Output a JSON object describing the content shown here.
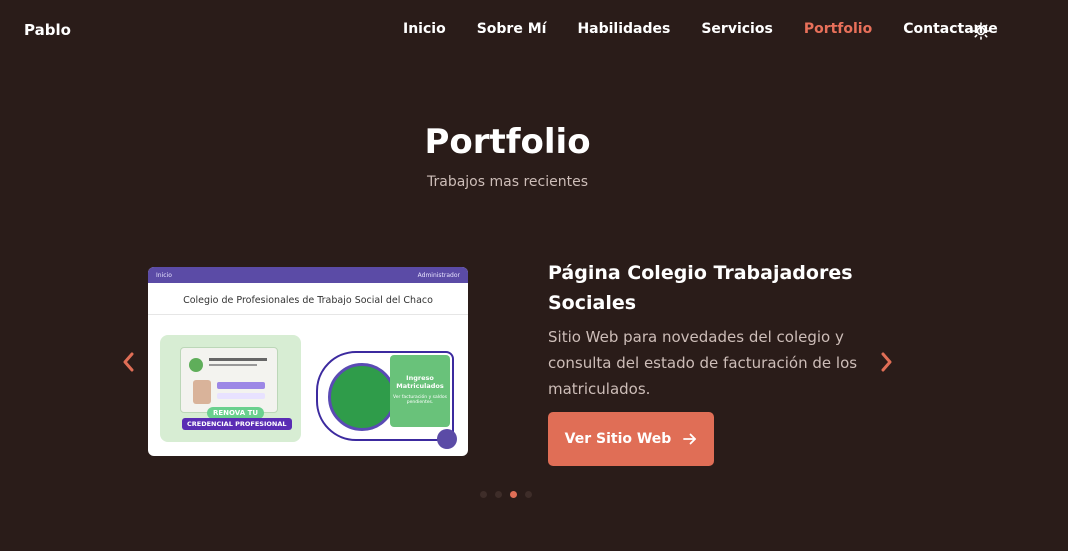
{
  "brand": "Pablo",
  "nav": {
    "items": [
      "Inicio",
      "Sobre Mí",
      "Habilidades",
      "Servicios",
      "Portfolio",
      "Contactame"
    ],
    "active_index": 4
  },
  "theme_toggle_icon": "sun-icon",
  "section": {
    "title": "Portfolio",
    "subtitle": "Trabajos mas recientes"
  },
  "project": {
    "title": "Página Colegio Trabajadores Sociales",
    "description": "Sitio Web para novedades del colegio y consulta del estado de facturación de los matriculados.",
    "button_label": "Ver Sitio Web",
    "button_icon": "arrow-right-icon",
    "screenshot": {
      "bar_left": "Inicio",
      "bar_right": "Administrador",
      "heading": "Colegio de Profesionales de Trabajo Social del Chaco",
      "renova": "RENOVA TU",
      "credencial": "CREDENCIAL PROFESIONAL",
      "ingreso_title": "Ingreso Matriculados",
      "ingreso_sub": "Ver facturación y saldos pendientes."
    }
  },
  "carousel": {
    "prev_icon": "chevron-left-icon",
    "next_icon": "chevron-right-icon",
    "dots_count": 4,
    "active_dot": 2
  },
  "colors": {
    "background": "#2a1c19",
    "accent": "#e06e56",
    "text_muted": "#cdbdb8"
  }
}
